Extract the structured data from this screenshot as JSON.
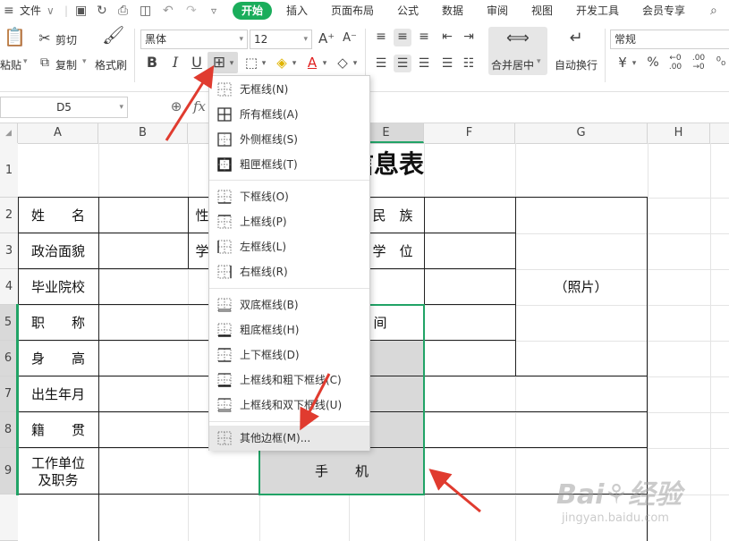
{
  "menubar": {
    "file": "文件",
    "tabs": [
      "开始",
      "插入",
      "页面布局",
      "公式",
      "数据",
      "审阅",
      "视图",
      "开发工具",
      "会员专享"
    ]
  },
  "ribbon": {
    "paste": "粘贴",
    "cut": "剪切",
    "copy": "复制",
    "format_painter": "格式刷",
    "font_name": "黑体",
    "font_size": "12",
    "merge_center": "合并居中",
    "wrap_text": "自动换行",
    "number_format": "常规",
    "bold": "B",
    "italic": "I",
    "underline": "U",
    "currency": "¥",
    "percent": "%"
  },
  "formula_bar": {
    "cell_ref": "D5",
    "fx": "fx"
  },
  "columns": [
    "A",
    "B",
    "C",
    "D",
    "E",
    "F",
    "G",
    "H"
  ],
  "rows": [
    "1",
    "2",
    "3",
    "4",
    "5",
    "6",
    "7",
    "8",
    "9"
  ],
  "sheet": {
    "title_visible": "信息表",
    "name_label": "姓　　名",
    "political": "政治面貌",
    "school": "毕业院校",
    "title_job": "职　　称",
    "height": "身　　高",
    "birth": "出生年月",
    "native": "籍　　贯",
    "work_unit": "工作单位\n及职务",
    "gender_partial": "性",
    "study_partial": "学",
    "ethnic": "民　族",
    "degree": "学　位",
    "time_partial": "间",
    "photo": "（照片）",
    "phone": "手　　机"
  },
  "border_menu": {
    "items": [
      "无框线(N)",
      "所有框线(A)",
      "外侧框线(S)",
      "粗匣框线(T)",
      "下框线(O)",
      "上框线(P)",
      "左框线(L)",
      "右框线(R)",
      "双底框线(B)",
      "粗底框线(H)",
      "上下框线(D)",
      "上框线和粗下框线(C)",
      "上框线和双下框线(U)",
      "其他边框(M)..."
    ]
  },
  "colors": {
    "accent": "#1aad5b",
    "annotation_red": "#e03b2f",
    "selection": "#21a366"
  }
}
